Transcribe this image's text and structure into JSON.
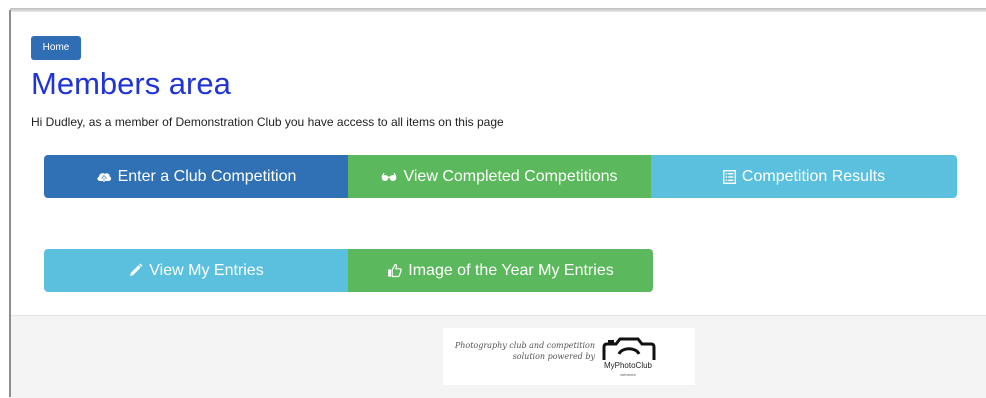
{
  "breadcrumb": {
    "home_label": "Home"
  },
  "page": {
    "title": "Members area",
    "greeting": "Hi Dudley, as a member of Demonstration Club you have access to all items on this page"
  },
  "buttons": [
    {
      "label": "Enter a Club Competition",
      "icon": "cloud-upload-icon",
      "color": "#3071b5"
    },
    {
      "label": "View Completed Competitions",
      "icon": "eyeglasses-icon",
      "color": "#5cb85c"
    },
    {
      "label": "Competition Results",
      "icon": "list-icon",
      "color": "#5bc0de"
    },
    {
      "label": "View My Entries",
      "icon": "pencil-icon",
      "color": "#5bc0de"
    },
    {
      "label": "Image of the Year My Entries",
      "icon": "thumbs-up-icon",
      "color": "#5cb85c"
    }
  ],
  "footer": {
    "tagline_line1": "Photography club and competition",
    "tagline_line2": "solution powered by",
    "brand_name": "MyPhotoClub",
    "brand_sub": "websites"
  }
}
